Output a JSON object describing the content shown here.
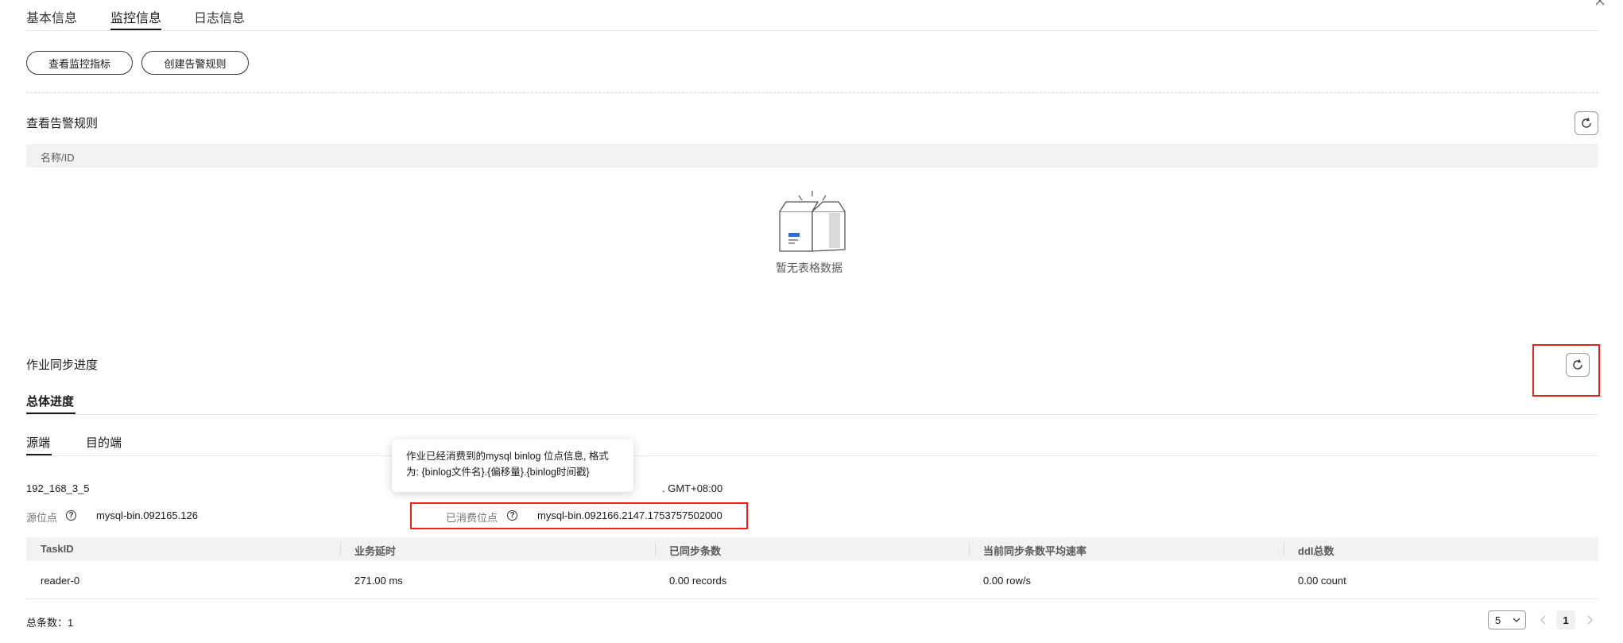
{
  "tabs": [
    "基本信息",
    "监控信息",
    "日志信息"
  ],
  "buttons": {
    "view_metrics": "查看监控指标",
    "create_alarm": "创建告警规则"
  },
  "alarm_section": {
    "title": "查看告警规则",
    "column": "名称/ID",
    "empty": "暂无表格数据"
  },
  "sync_section": {
    "title": "作业同步进度",
    "overall_tab": "总体进度",
    "subtabs": [
      "源端",
      "目的端"
    ]
  },
  "tooltip": "作业已经消费到的mysql binlog 位点信息, 格式为: {binlog文件名}.{偏移量}.{binlog时间戳}",
  "source": {
    "name": "192_168_3_5",
    "timezone_partial": ". GMT+08:00",
    "position_label": "源位点",
    "position_value": "mysql-bin.092165.126",
    "consumed_label": "已消费位点",
    "consumed_value": "mysql-bin.092166.2147.1753757502000"
  },
  "task_table": {
    "headers": [
      "TaskID",
      "业务延时",
      "已同步条数",
      "当前同步条数平均速率",
      "ddl总数"
    ],
    "rows": [
      [
        "reader-0",
        "271.00 ms",
        "0.00 records",
        "0.00 row/s",
        "0.00 count"
      ]
    ]
  },
  "footer": {
    "total": "总条数：1",
    "page_size": "5",
    "current_page": "1"
  },
  "colors": {
    "highlight": "#e4251d",
    "header_bg": "#f2f2f2"
  },
  "icons": [
    "close-icon",
    "refresh-icon",
    "question-icon",
    "empty-box-icon",
    "chevron-down-icon",
    "chevron-left-icon",
    "chevron-right-icon"
  ]
}
